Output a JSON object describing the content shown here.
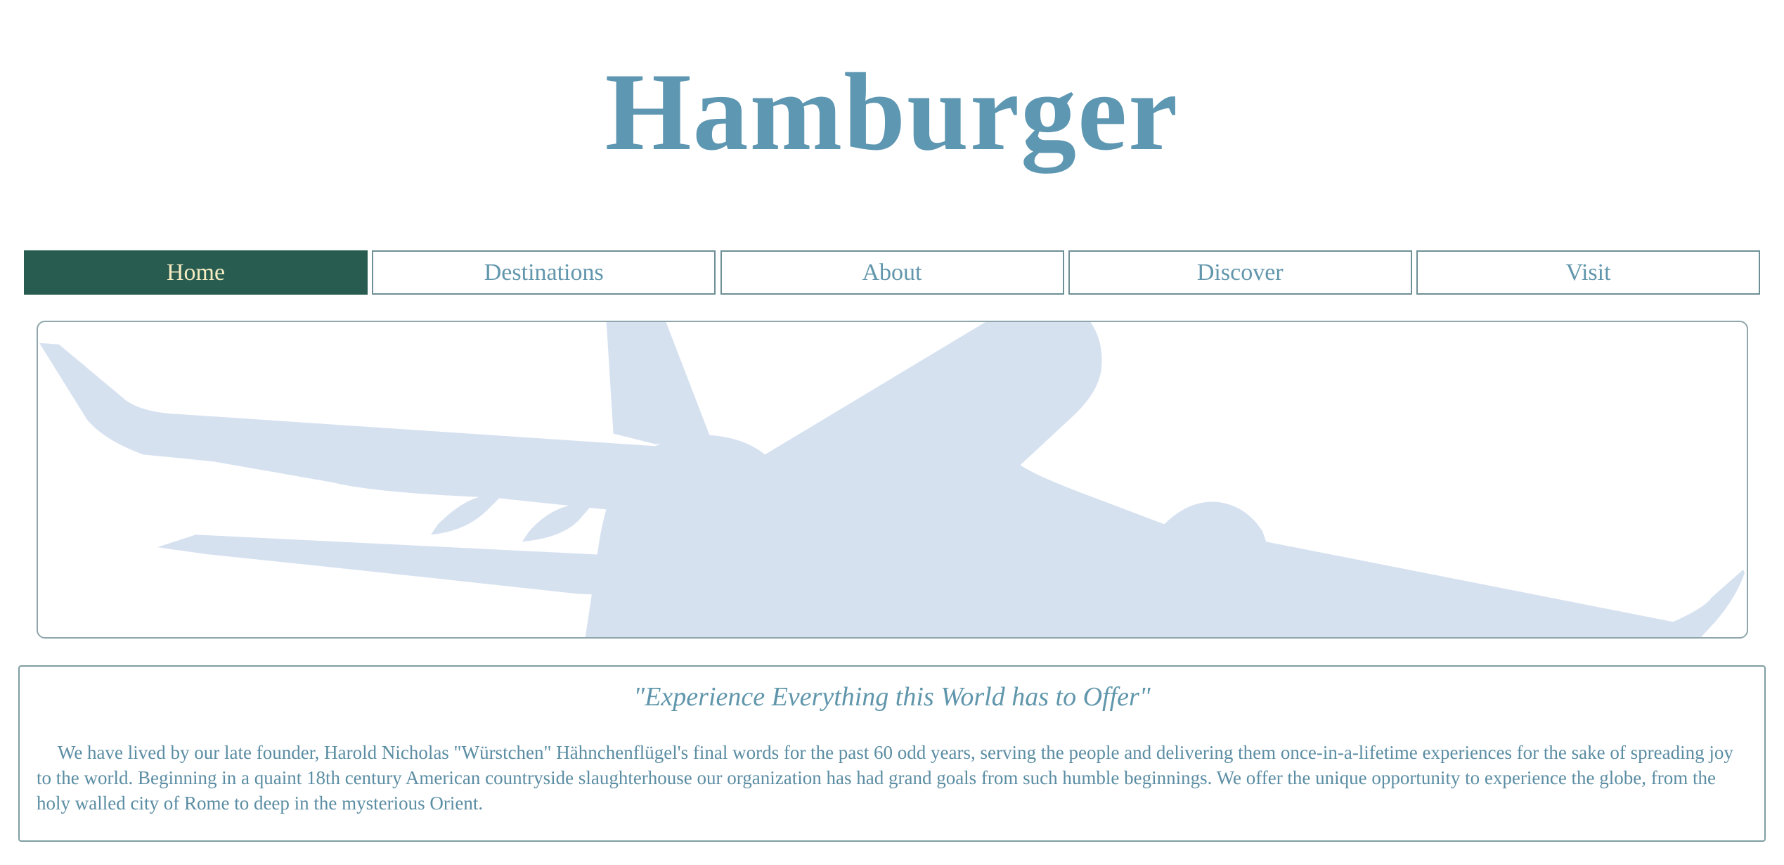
{
  "site": {
    "title": "Hamburger"
  },
  "nav": {
    "items": [
      {
        "label": "Home",
        "active": true
      },
      {
        "label": "Destinations",
        "active": false
      },
      {
        "label": "About",
        "active": false
      },
      {
        "label": "Discover",
        "active": false
      },
      {
        "label": "Visit",
        "active": false
      }
    ]
  },
  "hero": {
    "image": "airplane-silhouette",
    "color": "#d6e1f0"
  },
  "about": {
    "tagline": "\"Experience Everything this World has to Offer\"",
    "body": "We have lived by our late founder, Harold Nicholas \"Würstchen\" Hähnchenflügel's final words for the past 60 odd years, serving the people and delivering them once-in-a-lifetime experiences for the sake of spreading joy to the world. Beginning in a quaint 18th century American countryside slaughterhouse our organization has had grand goals from such humble beginnings. We offer the unique opportunity to experience the globe, from the holy walled city of Rome to deep in the mysterious Orient."
  },
  "colors": {
    "title": "#5e97b2",
    "nav_active_bg": "#285c51",
    "nav_active_text": "#f6ecc1",
    "nav_text": "#6196ac",
    "border": "#6e8f95"
  }
}
